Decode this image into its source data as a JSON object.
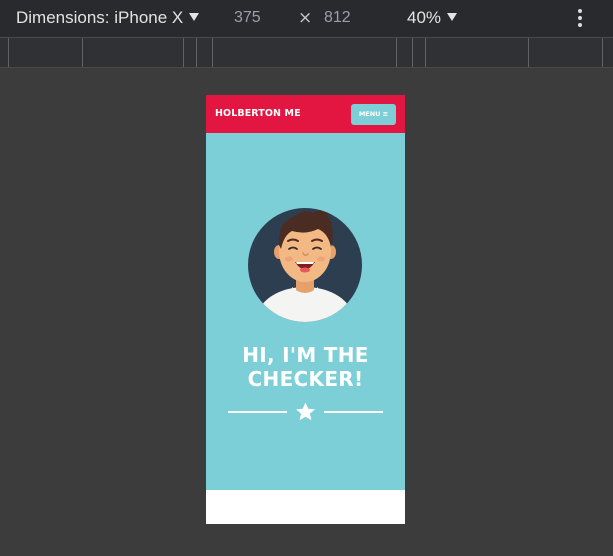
{
  "toolbar": {
    "device_label": "Dimensions: iPhone X",
    "width": "375",
    "times": "×",
    "height": "812",
    "zoom": "40%"
  },
  "site": {
    "brand": "HOLBERTON ME",
    "menu_label": "MENU ≡",
    "hero_line1": "HI, I'M THE",
    "hero_line2": "CHECKER!",
    "colors": {
      "header": "#e21641",
      "hero": "#7ccfd6",
      "avatar_circle": "#2d3e50"
    }
  },
  "icons": {
    "device_caret": "caret-down-icon",
    "zoom_caret": "caret-down-icon",
    "more": "vertical-ellipsis-icon",
    "star": "star-icon"
  }
}
